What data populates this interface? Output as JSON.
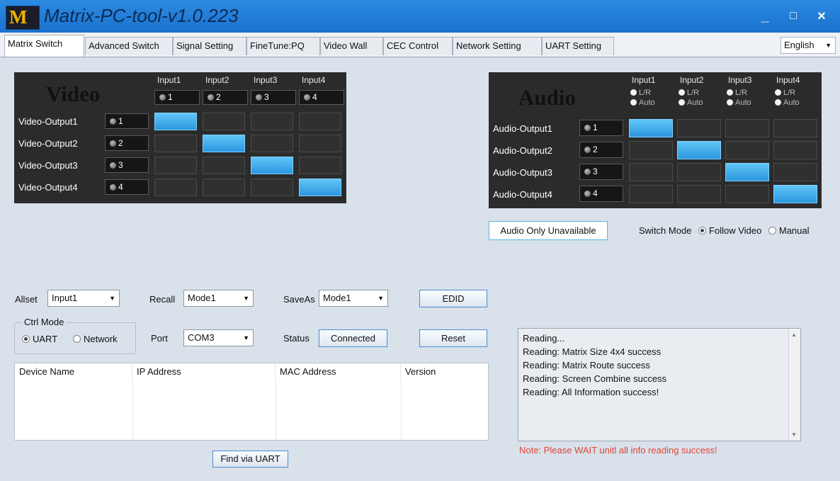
{
  "window": {
    "title": "Matrix-PC-tool-v1.0.223",
    "logo_text": "M",
    "min_icon": "_",
    "max_icon": "□",
    "close_icon": "×"
  },
  "tabs": [
    "Matrix Switch",
    "Advanced Switch",
    "Signal Setting",
    "FineTune:PQ",
    "Video Wall",
    "CEC Control",
    "Network Setting",
    "UART Setting"
  ],
  "language": "English",
  "video": {
    "title": "Video",
    "inputs": [
      "Input1",
      "Input2",
      "Input3",
      "Input4"
    ],
    "input_nums": [
      "1",
      "2",
      "3",
      "4"
    ],
    "outputs": [
      "Video-Output1",
      "Video-Output2",
      "Video-Output3",
      "Video-Output4"
    ],
    "output_nums": [
      "1",
      "2",
      "3",
      "4"
    ],
    "routes": [
      0,
      1,
      2,
      3
    ]
  },
  "audio": {
    "title": "Audio",
    "inputs": [
      "Input1",
      "Input2",
      "Input3",
      "Input4"
    ],
    "opt_lr": "L/R",
    "opt_auto": "Auto",
    "outputs": [
      "Audio-Output1",
      "Audio-Output2",
      "Audio-Output3",
      "Audio-Output4"
    ],
    "output_nums": [
      "1",
      "2",
      "3",
      "4"
    ],
    "routes": [
      0,
      1,
      2,
      3
    ]
  },
  "audio_only": "Audio Only Unavailable",
  "switch_mode": {
    "label": "Switch Mode",
    "follow": "Follow Video",
    "manual": "Manual"
  },
  "controls": {
    "allset_label": "Allset",
    "allset_value": "Input1",
    "recall_label": "Recall",
    "recall_value": "Mode1",
    "saveas_label": "SaveAs",
    "saveas_value": "Mode1",
    "edid": "EDID",
    "ctrl_mode": "Ctrl Mode",
    "uart": "UART",
    "network": "Network",
    "port_label": "Port",
    "port_value": "COM3",
    "status_label": "Status",
    "status_value": "Connected",
    "reset": "Reset",
    "find": "Find via UART"
  },
  "device_table": {
    "headers": [
      "Device Name",
      "IP Address",
      "MAC Address",
      "Version"
    ]
  },
  "log": [
    "Reading...",
    "Reading: Matrix Size 4x4 success",
    "Reading: Matrix Route success",
    "Reading: Screen Combine success",
    "Reading: All Information success!"
  ],
  "note": "Note: Please WAIT unitl all info reading success!",
  "colors": {
    "title_bar": "#1a72cf",
    "active_cell": "#2a96de",
    "note": "#e0453a"
  }
}
